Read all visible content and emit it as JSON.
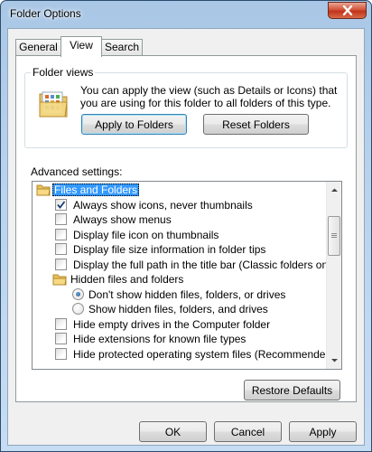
{
  "window": {
    "title": "Folder Options"
  },
  "tabs": [
    {
      "label": "General"
    },
    {
      "label": "View"
    },
    {
      "label": "Search"
    }
  ],
  "folder_views": {
    "legend": "Folder views",
    "description": "You can apply the view (such as Details or Icons) that you are using for this folder to all folders of this type.",
    "apply_label": "Apply to Folders",
    "reset_label": "Reset Folders"
  },
  "advanced": {
    "label": "Advanced settings:",
    "items": [
      {
        "type": "folder",
        "label": "Files and Folders",
        "selected": true
      },
      {
        "type": "checkbox",
        "label": "Always show icons, never thumbnails",
        "checked": true
      },
      {
        "type": "checkbox",
        "label": "Always show menus",
        "checked": false
      },
      {
        "type": "checkbox",
        "label": "Display file icon on thumbnails",
        "checked": false
      },
      {
        "type": "checkbox",
        "label": "Display file size information in folder tips",
        "checked": false
      },
      {
        "type": "checkbox",
        "label": "Display the full path in the title bar (Classic folders only)",
        "checked": false
      },
      {
        "type": "folder",
        "label": "Hidden files and folders"
      },
      {
        "type": "radio",
        "label": "Don't show hidden files, folders, or drives",
        "checked": true
      },
      {
        "type": "radio",
        "label": "Show hidden files, folders, and drives",
        "checked": false
      },
      {
        "type": "checkbox",
        "label": "Hide empty drives in the Computer folder",
        "checked": false
      },
      {
        "type": "checkbox",
        "label": "Hide extensions for known file types",
        "checked": false
      },
      {
        "type": "checkbox",
        "label": "Hide protected operating system files (Recommended)",
        "checked": false
      }
    ]
  },
  "restore_defaults_label": "Restore Defaults",
  "dialog_buttons": {
    "ok": "OK",
    "cancel": "Cancel",
    "apply": "Apply"
  }
}
